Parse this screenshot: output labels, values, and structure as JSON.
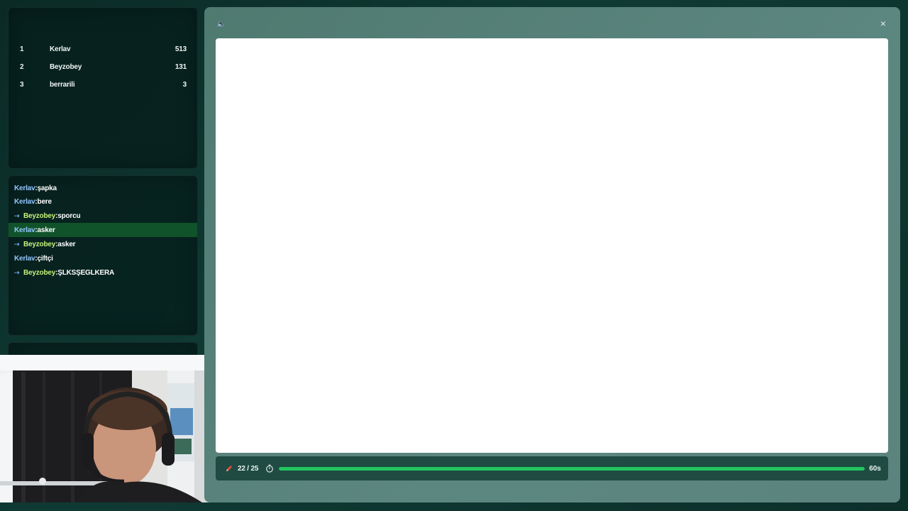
{
  "leaderboard": {
    "rows": [
      {
        "rank": "1",
        "name": "Kerlav",
        "score": "513"
      },
      {
        "rank": "2",
        "name": "Beyzobey",
        "score": "131"
      },
      {
        "rank": "3",
        "name": "berrarili",
        "score": "3"
      }
    ]
  },
  "chat": {
    "messages": [
      {
        "user": "Kerlav",
        "text": "şapka",
        "reply": false
      },
      {
        "user": "Kerlav",
        "text": "bere",
        "reply": false
      },
      {
        "user": "Beyzobey",
        "text": "sporcu",
        "reply": true
      },
      {
        "user": "Kerlav",
        "text": "asker",
        "reply": false,
        "highlight": true
      },
      {
        "user": "Beyzobey",
        "text": "asker",
        "reply": true
      },
      {
        "user": "Kerlav",
        "text": "çiftçi",
        "reply": false
      },
      {
        "user": "Beyzobey",
        "text": "ŞLKSŞEGLKERA",
        "reply": true
      }
    ],
    "separator": ":",
    "reply_glyph": "⇢"
  },
  "game": {
    "sound_icon": "speaker-icon",
    "close_icon": "close-icon",
    "sound_glyph": "🔈",
    "close_glyph": "×",
    "round_text": "22 / 25",
    "timer_text": "60s",
    "progress_fraction": 1.0,
    "colors": {
      "progress": "#22c55e",
      "pencil": "#e74c3c",
      "highlight": "#10532a"
    }
  }
}
